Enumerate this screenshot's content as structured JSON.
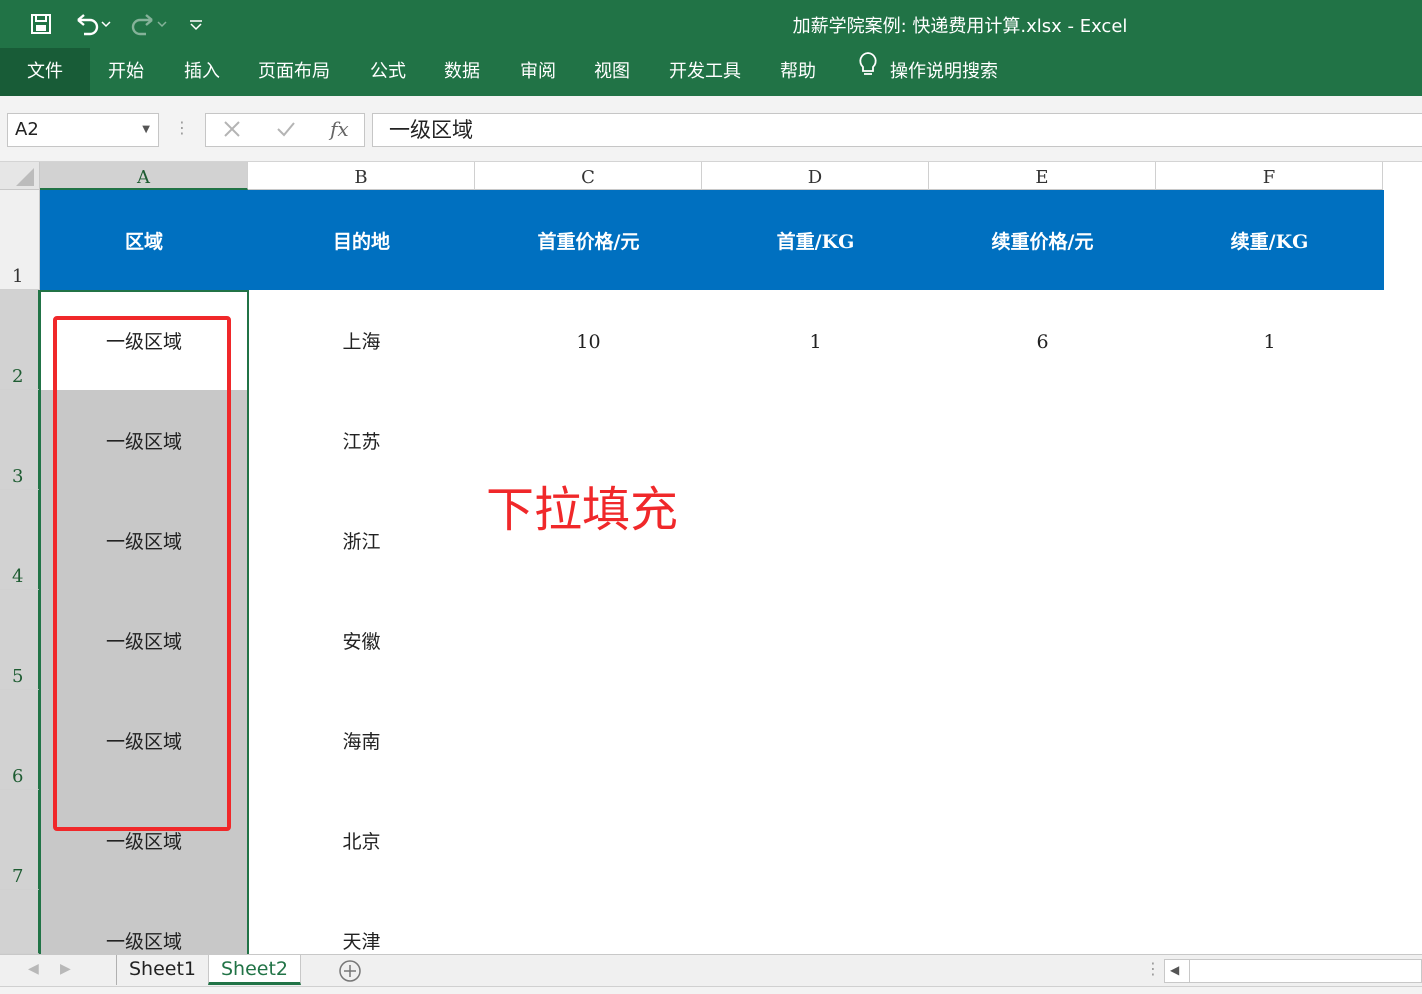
{
  "window": {
    "title": "加薪学院案例: 快递费用计算.xlsx  -  Excel",
    "accent": "#217346"
  },
  "quick_access": {
    "icons": [
      "save-icon",
      "undo-icon",
      "redo-icon",
      "customize-icon"
    ]
  },
  "ribbon": {
    "tabs": [
      "文件",
      "开始",
      "插入",
      "页面布局",
      "公式",
      "数据",
      "审阅",
      "视图",
      "开发工具",
      "帮助"
    ],
    "tell_me": "操作说明搜索"
  },
  "formula_bar": {
    "name_box": "A2",
    "content": "一级区域",
    "fx_label": "fx"
  },
  "grid": {
    "columns": [
      "A",
      "B",
      "C",
      "D",
      "E",
      "F"
    ],
    "rows": [
      "1",
      "2",
      "3",
      "4",
      "5",
      "6",
      "7"
    ],
    "header_row": [
      "区域",
      "目的地",
      "首重价格/元",
      "首重/KG",
      "续重价格/元",
      "续重/KG"
    ],
    "header_fill": "#0070c0",
    "data_rows": [
      [
        "一级区域",
        "上海",
        "10",
        "1",
        "6",
        "1"
      ],
      [
        "一级区域",
        "江苏",
        "",
        "",
        "",
        ""
      ],
      [
        "一级区域",
        "浙江",
        "",
        "",
        "",
        ""
      ],
      [
        "一级区域",
        "安徽",
        "",
        "",
        "",
        ""
      ],
      [
        "一级区域",
        "海南",
        "",
        "",
        "",
        ""
      ],
      [
        "一级区域",
        "北京",
        "",
        "",
        "",
        ""
      ],
      [
        "一级区域",
        "天津",
        "",
        "",
        "",
        ""
      ]
    ]
  },
  "annotation": {
    "text": "下拉填充",
    "color": "#f0282a"
  },
  "sheets": {
    "tabs": [
      "Sheet1",
      "Sheet2"
    ],
    "active": "Sheet2"
  }
}
